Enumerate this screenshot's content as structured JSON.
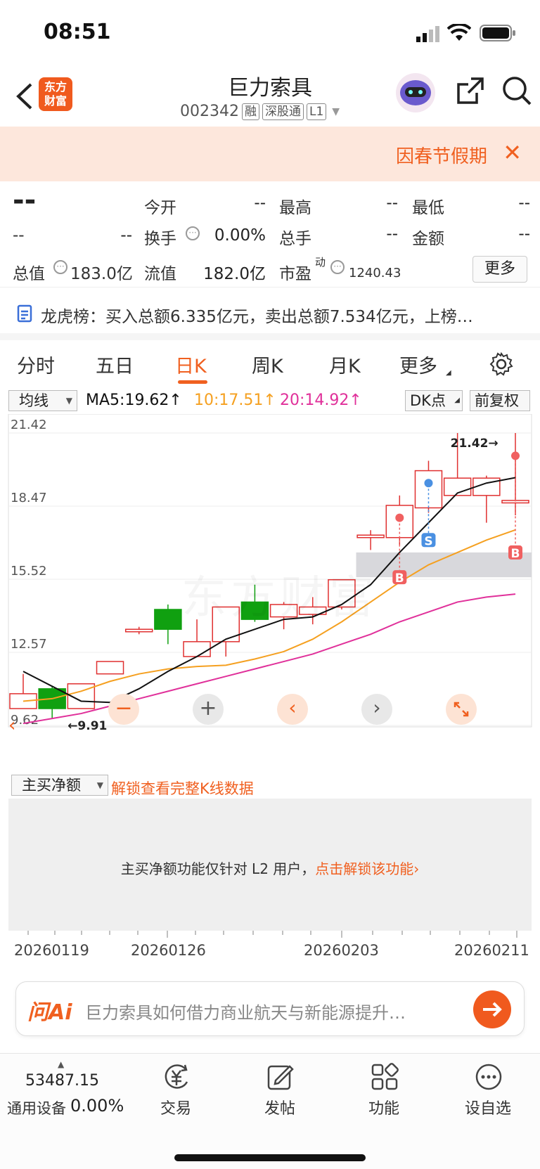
{
  "status": {
    "time": "08:51"
  },
  "header": {
    "logo": "东方财富",
    "title": "巨力索具",
    "code": "002342",
    "tags": [
      "融",
      "深股通",
      "L1"
    ]
  },
  "notice": {
    "text": "因春节假期"
  },
  "quote": {
    "price": "--",
    "change": "--",
    "change_pct": "--",
    "open_label": "今开",
    "open_value": "--",
    "high_label": "最高",
    "high_value": "--",
    "low_label": "最低",
    "low_value": "--",
    "turnover_label": "换手",
    "turnover_value": "0.00%",
    "volume_label": "总手",
    "volume_value": "--",
    "amount_label": "金额",
    "amount_value": "--",
    "mktcap_label": "总值",
    "mktcap_value": "183.0亿",
    "float_label": "流值",
    "float_value": "182.0亿",
    "pe_label": "市盈",
    "pe_sup": "动",
    "pe_value": "1240.43",
    "more_label": "更多"
  },
  "dragon": {
    "text": "龙虎榜：买入总额6.335亿元，卖出总额7.534亿元，上榜…"
  },
  "tabs": [
    "分时",
    "五日",
    "日K",
    "周K",
    "月K",
    "更多"
  ],
  "active_tab": "日K",
  "ma": {
    "selector": "均线",
    "ma5": "MA5:19.62↑",
    "ma10": "10:17.51↑",
    "ma20": "20:14.92↑",
    "dk": "DK点",
    "adjust": "前复权",
    "colors": {
      "ma5": "#111111",
      "ma10": "#f5a020",
      "ma20": "#e0309a",
      "up": "#e03030",
      "down": "#10a010"
    }
  },
  "chart_data": {
    "type": "candlestick",
    "ylim": [
      9.62,
      21.42
    ],
    "y_ticks": [
      "21.42",
      "18.47",
      "15.52",
      "12.57",
      "9.62"
    ],
    "high_label": "21.42→",
    "low_label": "←9.91",
    "candles": [
      {
        "open": 10.3,
        "close": 10.9,
        "high": 11.7,
        "low": 10.3
      },
      {
        "open": 11.1,
        "close": 10.3,
        "high": 11.2,
        "low": 9.91
      },
      {
        "open": 10.3,
        "close": 11.3,
        "high": 11.3,
        "low": 10.3
      },
      {
        "open": 11.7,
        "close": 12.2,
        "high": 12.2,
        "low": 11.7
      },
      {
        "open": 13.4,
        "close": 13.5,
        "high": 13.6,
        "low": 13.3
      },
      {
        "open": 14.3,
        "close": 13.5,
        "high": 14.5,
        "low": 12.9
      },
      {
        "open": 12.4,
        "close": 13.0,
        "high": 13.9,
        "low": 12.4
      },
      {
        "open": 13.0,
        "close": 14.4,
        "high": 14.4,
        "low": 12.4
      },
      {
        "open": 14.6,
        "close": 13.9,
        "high": 15.3,
        "low": 13.8
      },
      {
        "open": 14.0,
        "close": 14.5,
        "high": 14.6,
        "low": 13.5
      },
      {
        "open": 14.1,
        "close": 14.4,
        "high": 14.8,
        "low": 13.7
      },
      {
        "open": 14.4,
        "close": 15.5,
        "high": 15.5,
        "low": 14.3
      },
      {
        "open": 17.2,
        "close": 17.3,
        "high": 17.5,
        "low": 16.7
      },
      {
        "open": 17.2,
        "close": 18.5,
        "high": 18.9,
        "low": 16.9
      },
      {
        "open": 18.4,
        "close": 19.9,
        "high": 20.3,
        "low": 18.2
      },
      {
        "open": 18.9,
        "close": 19.6,
        "high": 21.42,
        "low": 18.9
      },
      {
        "open": 18.9,
        "close": 19.6,
        "high": 19.7,
        "low": 17.8
      },
      {
        "open": 18.6,
        "close": 18.7,
        "high": 21.42,
        "low": 18.1
      }
    ],
    "ma5": [
      11.8,
      11.2,
      10.6,
      10.55,
      11.1,
      11.8,
      12.4,
      13.1,
      13.5,
      13.9,
      14.0,
      14.5,
      15.3,
      16.6,
      17.8,
      19.0,
      19.4,
      19.62
    ],
    "ma10": [
      10.6,
      10.7,
      11.0,
      11.4,
      11.7,
      11.9,
      12.0,
      12.05,
      12.3,
      12.6,
      13.1,
      13.8,
      14.6,
      15.4,
      16.1,
      16.6,
      17.1,
      17.51
    ],
    "ma20": [
      9.7,
      9.9,
      10.1,
      10.4,
      10.7,
      11.0,
      11.3,
      11.6,
      11.9,
      12.2,
      12.5,
      12.9,
      13.3,
      13.8,
      14.2,
      14.6,
      14.8,
      14.92
    ],
    "zone": {
      "from_index": 11.5,
      "low": 15.6,
      "high": 16.6
    },
    "markers": [
      {
        "index": 13,
        "type": "B",
        "value": 15.6
      },
      {
        "index": 14,
        "type": "S",
        "value": 17.1
      },
      {
        "index": 17,
        "type": "B",
        "value": 16.6
      }
    ],
    "dots": [
      {
        "index": 13,
        "value": 18.0,
        "color": "#f06060"
      },
      {
        "index": 14,
        "value": 19.4,
        "color": "#4a90e2"
      },
      {
        "index": 17,
        "value": 20.5,
        "color": "#f06060"
      }
    ],
    "watermark": "东方财富"
  },
  "sub": {
    "selector": "主买净额",
    "unlock": "解锁查看完整K线数据",
    "msg_main": "主买净额功能仅针对 L2 用户，",
    "msg_link": "点击解锁该功能",
    "dates": [
      "20260119",
      "20260126",
      "20260203",
      "20260211"
    ]
  },
  "ai": {
    "logo": "问Ai",
    "placeholder": "巨力索具如何借力商业航天与新能源提升…"
  },
  "nav": {
    "index_value": "53487.15",
    "index_name": "通用设备",
    "index_pct": "0.00%",
    "items": [
      "交易",
      "发帖",
      "功能",
      "设自选"
    ]
  }
}
